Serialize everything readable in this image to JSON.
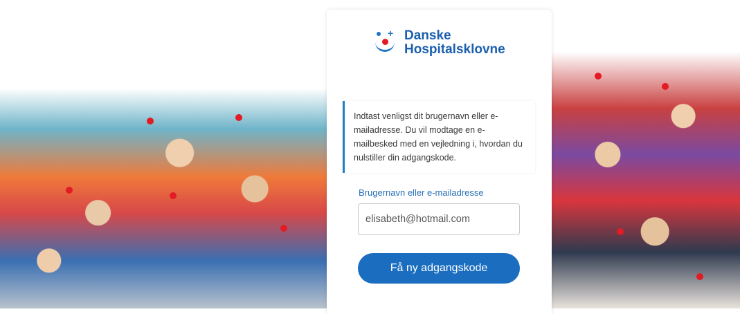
{
  "brand": {
    "name_line1": "Danske",
    "name_line2": "Hospitalsklovne",
    "colors": {
      "primary": "#1b6ebf",
      "nose_red": "#e21b24"
    },
    "logo_icon": "clown-face-logo-icon"
  },
  "reset_form": {
    "info_text": "Indtast venligst dit brugernavn eller e-mailadresse. Du vil modtage en e-mailbesked med en vejledning i, hvordan du nulstiller din adgangskode.",
    "field_label": "Brugernavn eller e-mailadresse",
    "field_value": "elisabeth@hotmail.com",
    "submit_label": "Få ny adgangskode"
  }
}
